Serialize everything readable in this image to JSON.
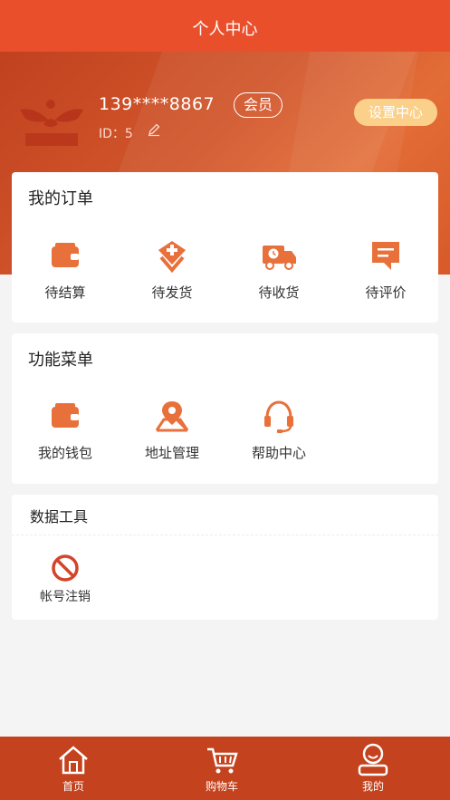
{
  "header": {
    "title": "个人中心"
  },
  "profile": {
    "phone": "139****8867",
    "member_badge": "会员",
    "id_text": "ID：5",
    "settings_label": "设置中心",
    "logo_icon": "brand-logo-icon"
  },
  "orders": {
    "title": "我的订单",
    "items": [
      {
        "label": "待结算",
        "icon": "wallet-icon"
      },
      {
        "label": "待发货",
        "icon": "package-icon"
      },
      {
        "label": "待收货",
        "icon": "truck-icon"
      },
      {
        "label": "待评价",
        "icon": "comment-icon"
      }
    ]
  },
  "functions": {
    "title": "功能菜单",
    "items": [
      {
        "label": "我的钱包",
        "icon": "wallet-icon"
      },
      {
        "label": "地址管理",
        "icon": "location-icon"
      },
      {
        "label": "帮助中心",
        "icon": "headset-icon"
      }
    ]
  },
  "tools": {
    "title": "数据工具",
    "items": [
      {
        "label": "帐号注销",
        "icon": "ban-icon"
      }
    ]
  },
  "tabbar": {
    "items": [
      {
        "label": "首页",
        "icon": "home-icon"
      },
      {
        "label": "购物车",
        "icon": "cart-icon"
      },
      {
        "label": "我的",
        "icon": "user-icon",
        "active": true
      }
    ]
  },
  "colors": {
    "brand": "#ea4f2c",
    "icon_orange": "#e8703a",
    "tabbar": "#c4421d",
    "settings_bg": "#fbd08a",
    "ban_red": "#d4442a"
  }
}
